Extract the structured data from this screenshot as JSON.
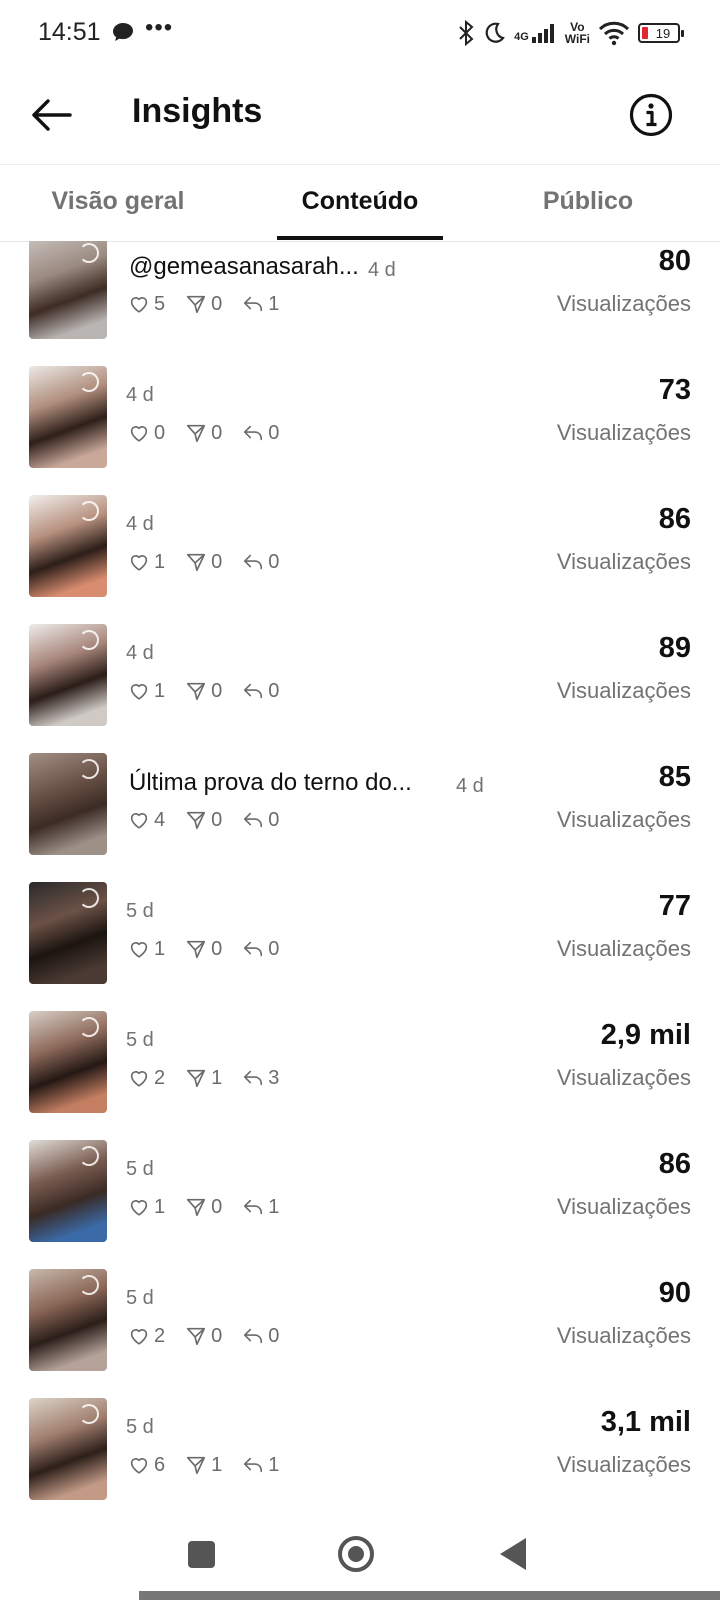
{
  "status": {
    "time": "14:51",
    "network": "4G",
    "vowifi": [
      "Vo",
      "WiFi"
    ],
    "battery": "19",
    "battery_low_color": "#e0282e"
  },
  "header": {
    "title": "Insights"
  },
  "tabs": [
    {
      "label": "Visão geral",
      "active": false
    },
    {
      "label": "Conteúdo",
      "active": true
    },
    {
      "label": "Público",
      "active": false
    }
  ],
  "posts": [
    {
      "caption": "@gemeasanasarah...",
      "age": "4 d",
      "likes": "5",
      "shares": "0",
      "replies": "1",
      "views": "80",
      "views_label": "Visualizações"
    },
    {
      "caption": "",
      "age": "4 d",
      "likes": "0",
      "shares": "0",
      "replies": "0",
      "views": "73",
      "views_label": "Visualizações"
    },
    {
      "caption": "",
      "age": "4 d",
      "likes": "1",
      "shares": "0",
      "replies": "0",
      "views": "86",
      "views_label": "Visualizações"
    },
    {
      "caption": "",
      "age": "4 d",
      "likes": "1",
      "shares": "0",
      "replies": "0",
      "views": "89",
      "views_label": "Visualizações"
    },
    {
      "caption": "Última prova do terno do...",
      "age": "4 d",
      "likes": "4",
      "shares": "0",
      "replies": "0",
      "views": "85",
      "views_label": "Visualizações"
    },
    {
      "caption": "",
      "age": "5 d",
      "likes": "1",
      "shares": "0",
      "replies": "0",
      "views": "77",
      "views_label": "Visualizações"
    },
    {
      "caption": "",
      "age": "5 d",
      "likes": "2",
      "shares": "1",
      "replies": "3",
      "views": "2,9 mil",
      "views_label": "Visualizações"
    },
    {
      "caption": "",
      "age": "5 d",
      "likes": "1",
      "shares": "0",
      "replies": "1",
      "views": "86",
      "views_label": "Visualizações"
    },
    {
      "caption": "",
      "age": "5 d",
      "likes": "2",
      "shares": "0",
      "replies": "0",
      "views": "90",
      "views_label": "Visualizações"
    },
    {
      "caption": "",
      "age": "5 d",
      "likes": "6",
      "shares": "1",
      "replies": "1",
      "views": "3,1 mil",
      "views_label": "Visualizações"
    }
  ],
  "icons": {
    "back": "arrow-left-icon",
    "info": "info-circle-icon",
    "like": "heart-icon",
    "share": "send-icon",
    "reply": "reply-icon"
  }
}
